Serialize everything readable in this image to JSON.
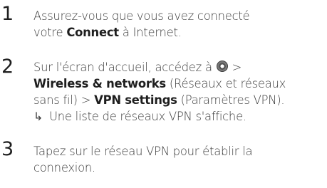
{
  "steps": [
    {
      "number": "1",
      "line1": "Assurez-vous que vous avez connecté",
      "line2_pre": "votre ",
      "line2_bold": "Connect",
      "line2_post": " à Internet."
    },
    {
      "number": "2",
      "line1_pre": "Sur l'écran d'accueil, accédez à ",
      "icon": "settings-icon",
      "line1_post": " >",
      "line2_bold": "Wireless & networks",
      "line2_post": " (Réseaux et réseaux",
      "line3_pre": "sans fil) > ",
      "line3_bold": "VPN settings",
      "line3_post": " (Paramètres VPN).",
      "result_arrow": "↳",
      "result_text": "Une liste de réseaux VPN s'affiche."
    },
    {
      "number": "3",
      "line1": "Tapez sur le réseau VPN pour établir la",
      "line2": "connexion."
    }
  ]
}
